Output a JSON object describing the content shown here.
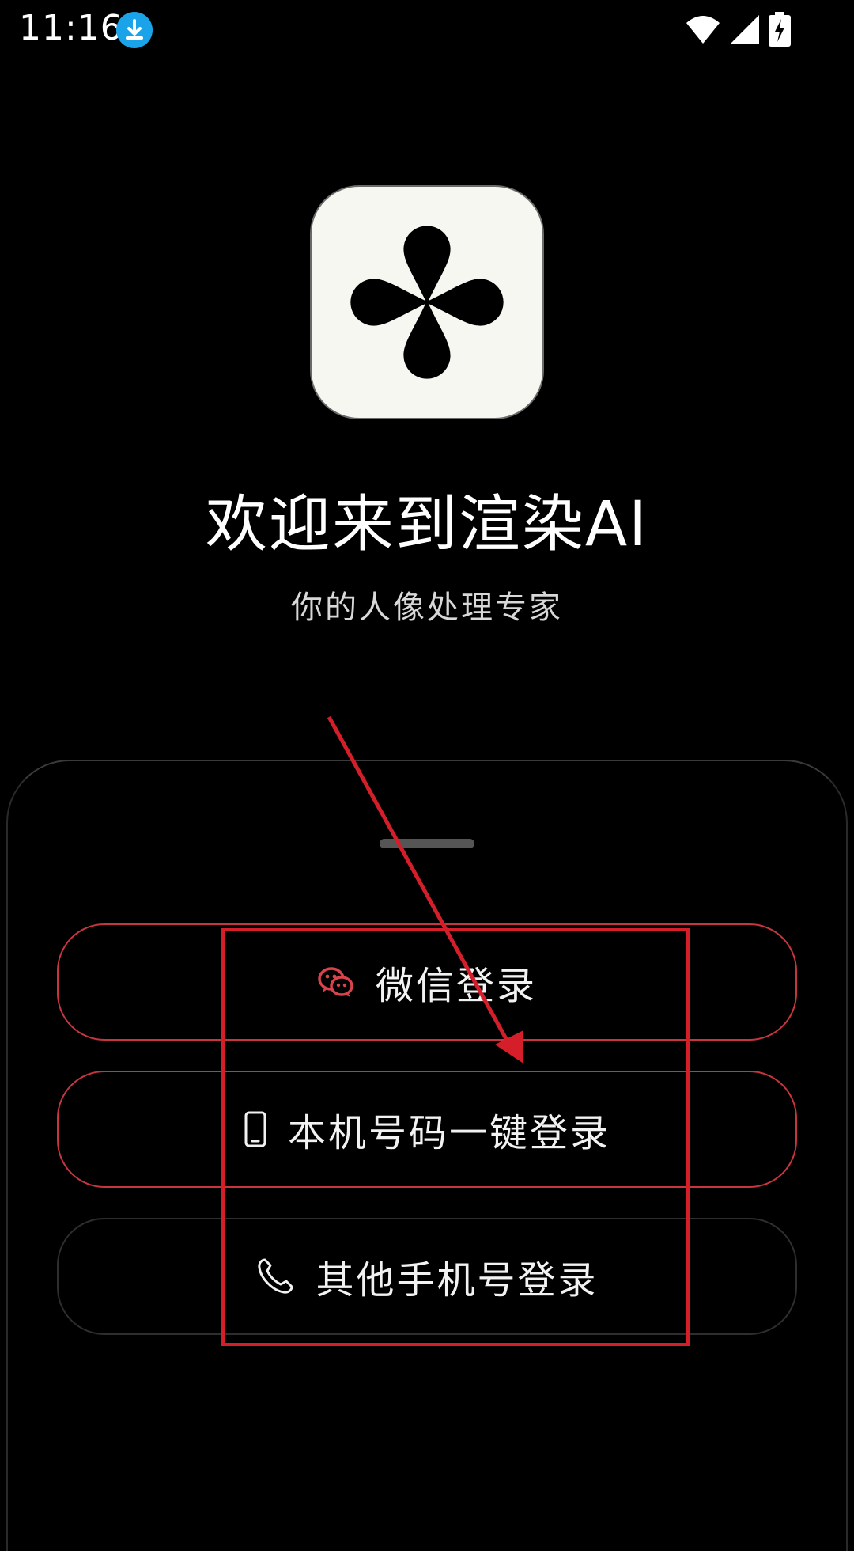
{
  "status_bar": {
    "time": "11:16",
    "icons": [
      "download-icon",
      "wifi-icon",
      "signal-icon",
      "battery-charging-icon"
    ]
  },
  "app": {
    "logo_icon": "clover-petal-icon",
    "title": "欢迎来到渲染AI",
    "subtitle": "你的人像处理专家"
  },
  "login_sheet": {
    "buttons": [
      {
        "label": "微信登录",
        "icon": "wechat-icon"
      },
      {
        "label": "本机号码一键登录",
        "icon": "mobile-phone-icon"
      },
      {
        "label": "其他手机号登录",
        "icon": "phone-handset-icon"
      }
    ]
  },
  "colors": {
    "background": "#000000",
    "accent_red": "#c9353f",
    "annotation_red": "#d41f2b",
    "download_badge": "#1aa3e8"
  }
}
